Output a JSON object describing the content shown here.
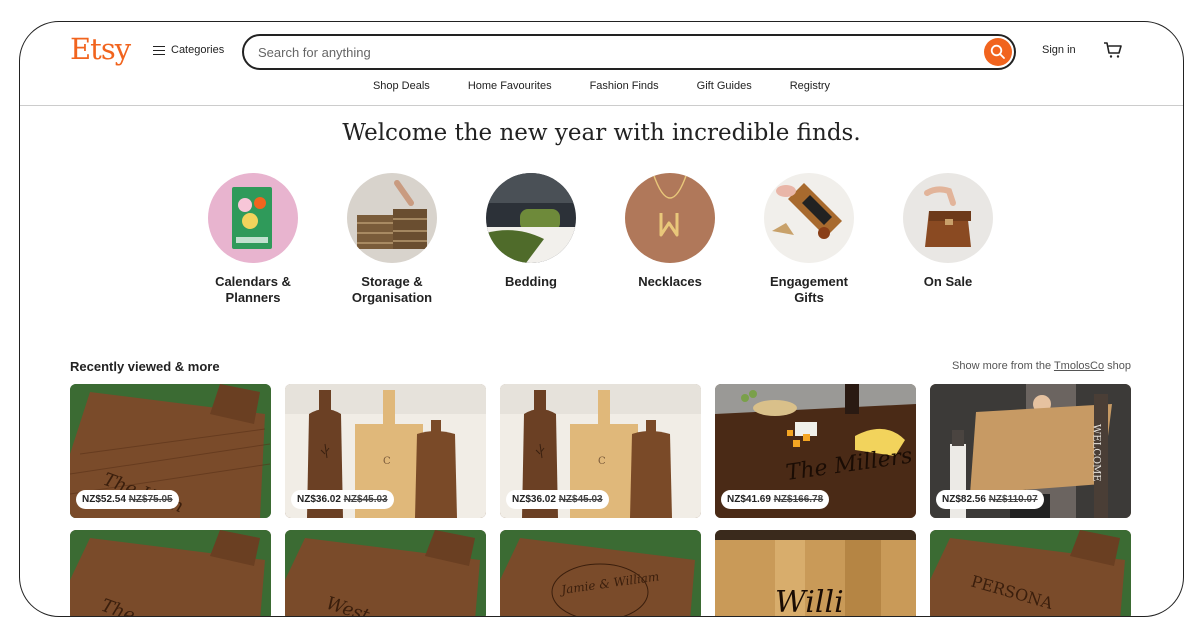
{
  "header": {
    "logo": "Etsy",
    "categories_label": "Categories",
    "search_placeholder": "Search for anything",
    "signin_label": "Sign in"
  },
  "subnav": [
    "Shop Deals",
    "Home Favourites",
    "Fashion Finds",
    "Gift Guides",
    "Registry"
  ],
  "headline": "Welcome the new year with incredible finds.",
  "categories": [
    {
      "label": "Calendars & Planners",
      "lines": [
        "Calendars &",
        "Planners"
      ]
    },
    {
      "label": "Storage & Organisation",
      "lines": [
        "Storage &",
        "Organisation"
      ]
    },
    {
      "label": "Bedding",
      "lines": [
        "Bedding",
        ""
      ]
    },
    {
      "label": "Necklaces",
      "lines": [
        "Necklaces",
        ""
      ]
    },
    {
      "label": "Engagement Gifts",
      "lines": [
        "Engagement",
        "Gifts"
      ]
    },
    {
      "label": "On Sale",
      "lines": [
        "On Sale",
        ""
      ]
    }
  ],
  "recently_viewed": {
    "title": "Recently viewed & more",
    "more_prefix": "Show more from the ",
    "more_shop": "TmolosCo",
    "more_suffix": " shop"
  },
  "products": [
    {
      "price": "NZ$52.54",
      "old_price": "NZ$75.05",
      "engraving": "The Hom"
    },
    {
      "price": "NZ$36.02",
      "old_price": "NZ$45.03",
      "engraving": ""
    },
    {
      "price": "NZ$36.02",
      "old_price": "NZ$45.03",
      "engraving": ""
    },
    {
      "price": "NZ$41.69",
      "old_price": "NZ$166.78",
      "engraving": "The Millers"
    },
    {
      "price": "NZ$82.56",
      "old_price": "NZ$110.07",
      "engraving": "WELCOME"
    }
  ],
  "products_row2": [
    {
      "engraving": "The"
    },
    {
      "engraving": "West"
    },
    {
      "engraving": "Jamie & William"
    },
    {
      "engraving": "Willi"
    },
    {
      "engraving": "PERSONA"
    }
  ],
  "colors": {
    "accent": "#f1641e",
    "text": "#222222"
  }
}
